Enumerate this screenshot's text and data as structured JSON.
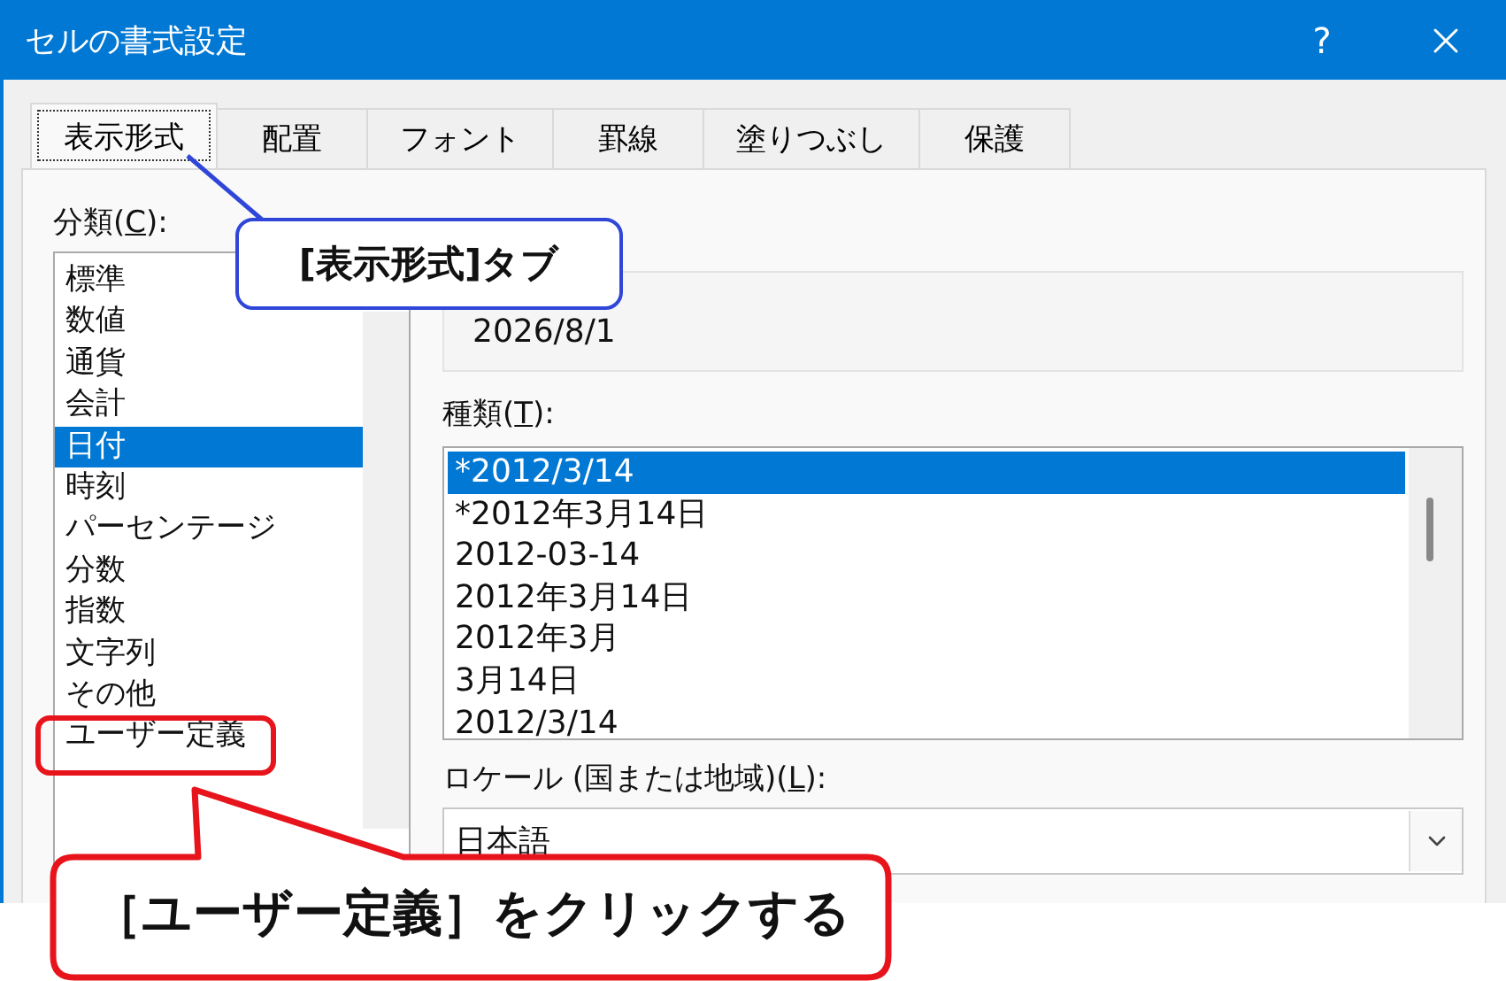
{
  "window": {
    "title": "セルの書式設定",
    "help": "?"
  },
  "tabs": [
    {
      "label": "表示形式",
      "selected": true
    },
    {
      "label": "配置",
      "selected": false
    },
    {
      "label": "フォント",
      "selected": false
    },
    {
      "label": "罫線",
      "selected": false
    },
    {
      "label": "塗りつぶし",
      "selected": false
    },
    {
      "label": "保護",
      "selected": false
    }
  ],
  "category": {
    "label": {
      "pre": "分類(",
      "key": "C",
      "post": "):"
    },
    "items": [
      {
        "label": "標準",
        "selected": false,
        "highlighted": false
      },
      {
        "label": "数値",
        "selected": false,
        "highlighted": false
      },
      {
        "label": "通貨",
        "selected": false,
        "highlighted": false
      },
      {
        "label": "会計",
        "selected": false,
        "highlighted": false
      },
      {
        "label": "日付",
        "selected": true,
        "highlighted": false
      },
      {
        "label": "時刻",
        "selected": false,
        "highlighted": false
      },
      {
        "label": "パーセンテージ",
        "selected": false,
        "highlighted": false
      },
      {
        "label": "分数",
        "selected": false,
        "highlighted": false
      },
      {
        "label": "指数",
        "selected": false,
        "highlighted": false
      },
      {
        "label": "文字列",
        "selected": false,
        "highlighted": false
      },
      {
        "label": "その他",
        "selected": false,
        "highlighted": false
      },
      {
        "label": "ユーザー定義",
        "selected": false,
        "highlighted": true
      }
    ]
  },
  "sample": {
    "value": "2026/8/1"
  },
  "type": {
    "label": {
      "pre": "種類(",
      "key": "T",
      "post": "):"
    },
    "items": [
      {
        "label": "*2012/3/14",
        "selected": true
      },
      {
        "label": "*2012年3月14日",
        "selected": false
      },
      {
        "label": "2012-03-14",
        "selected": false
      },
      {
        "label": "2012年3月14日",
        "selected": false
      },
      {
        "label": "2012年3月",
        "selected": false
      },
      {
        "label": "3月14日",
        "selected": false
      },
      {
        "label": "2012/3/14",
        "selected": false
      }
    ]
  },
  "locale": {
    "label": {
      "pre": "ロケール (国または地域)(",
      "key": "L",
      "post": "):"
    },
    "value": "日本語"
  },
  "callouts": [
    {
      "kind": "tab-note",
      "text": "[表示形式]タブ"
    },
    {
      "kind": "click-note",
      "text": "［ユーザー定義］をクリックする"
    }
  ]
}
